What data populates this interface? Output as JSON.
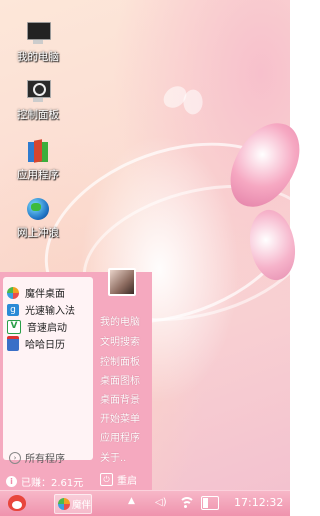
{
  "desktop": {
    "icons": [
      {
        "label": "我的电脑",
        "icon": "computer-icon"
      },
      {
        "label": "控制面板",
        "icon": "control-panel-icon"
      },
      {
        "label": "应用程序",
        "icon": "applications-icon"
      },
      {
        "label": "网上冲浪",
        "icon": "browser-globe-icon"
      }
    ]
  },
  "start_menu": {
    "apps": [
      {
        "label": "魔伴桌面",
        "icon": "pinwheel-icon",
        "color": "#f0a020"
      },
      {
        "label": "光速输入法",
        "icon": "keyboard-g-icon",
        "color": "#2b8ad6"
      },
      {
        "label": "音速启动",
        "icon": "v-launcher-icon",
        "color": "#2aa04a"
      },
      {
        "label": "哈哈日历",
        "icon": "calendar-icon",
        "color": "#3a6fc7"
      }
    ],
    "all_programs": "所有程序",
    "right_items": [
      "我的电脑",
      "文明搜索",
      "控制面板",
      "桌面图标",
      "桌面背景",
      "开始菜单",
      "应用程序",
      "关于.."
    ],
    "earned": "已赚：2.61元",
    "restart": "重启"
  },
  "taskbar": {
    "running_app": "魔伴",
    "clock": "17:12:32"
  },
  "colors": {
    "menu_pink": "#f5a9bf",
    "taskbar_pink": "#ef93ad"
  }
}
